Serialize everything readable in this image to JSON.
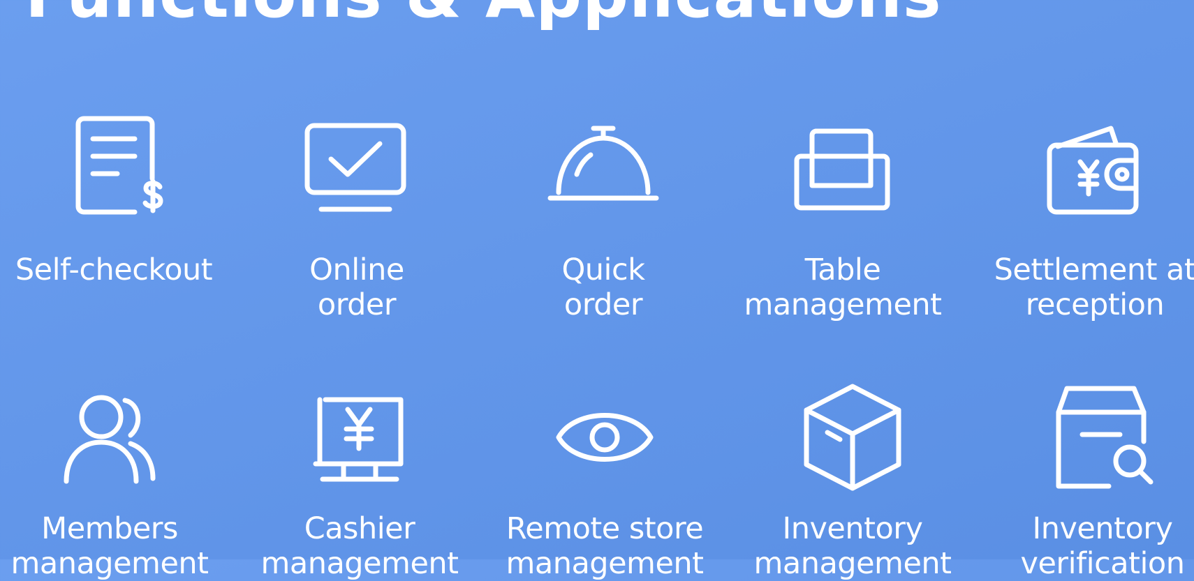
{
  "page": {
    "title": "Functions & Applications"
  },
  "items": [
    {
      "line1": "Self-checkout",
      "line2": "",
      "icon": "receipt-dollar-icon"
    },
    {
      "line1": "Online",
      "line2": "order",
      "icon": "monitor-check-icon"
    },
    {
      "line1": "Quick",
      "line2": "order",
      "icon": "service-bell-icon"
    },
    {
      "line1": "Table",
      "line2": "management",
      "icon": "armchair-icon"
    },
    {
      "line1": "Settlement at",
      "line2": "reception",
      "icon": "wallet-yen-icon"
    },
    {
      "line1": "Members",
      "line2": "management",
      "icon": "users-icon"
    },
    {
      "line1": "Cashier",
      "line2": "management",
      "icon": "monitor-yen-icon"
    },
    {
      "line1": "Remote store",
      "line2": "management",
      "icon": "eye-icon"
    },
    {
      "line1": "Inventory",
      "line2": "management",
      "icon": "box-icon"
    },
    {
      "line1": "Inventory",
      "line2": "verification",
      "icon": "box-search-icon"
    }
  ]
}
